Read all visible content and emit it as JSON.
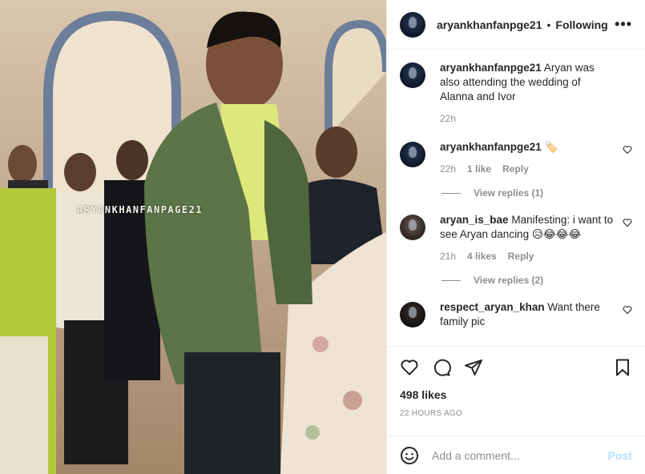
{
  "photo": {
    "watermark": "ARYANKHANFANPAGE21"
  },
  "header": {
    "username": "aryankhanfanpge21",
    "separator": "•",
    "follow_label": "Following",
    "more_icon": "more-horizontal-icon"
  },
  "comments": [
    {
      "username": "aryankhanfanpge21",
      "text": "Aryan was also attending the wedding of Alanna and Ivor",
      "time": "22h"
    },
    {
      "username": "aryankhanfanpge21",
      "text": "🏷️",
      "time": "22h",
      "likes": "1 like",
      "reply": "Reply",
      "view_replies": "View replies (1)"
    },
    {
      "username": "aryan_is_bae",
      "text": "Manifesting: i want to see Aryan dancing 😥😂😂😂",
      "time": "21h",
      "likes": "4 likes",
      "reply": "Reply",
      "view_replies": "View replies (2)"
    },
    {
      "username": "respect_aryan_khan",
      "text": "Want there family pic"
    }
  ],
  "actions": {
    "likes": "498 likes",
    "timestamp": "22 HOURS AGO",
    "icons": [
      "heart-icon",
      "comment-icon",
      "share-icon",
      "bookmark-icon"
    ]
  },
  "add_comment": {
    "placeholder": "Add a comment...",
    "post_label": "Post",
    "post_color": "#b2dffc"
  }
}
